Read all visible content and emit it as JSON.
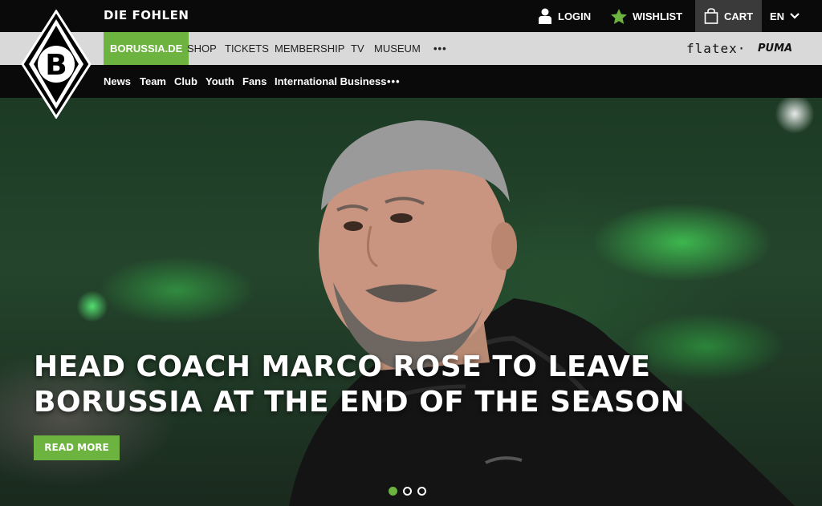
{
  "header": {
    "title": "DIE FOHLEN",
    "login_label": "LOGIN",
    "wishlist_label": "WISHLIST",
    "cart_label": "CART",
    "language": "EN"
  },
  "main_nav": {
    "items": [
      {
        "label": "BORUSSIA.DE"
      },
      {
        "label": "SHOP"
      },
      {
        "label": "TICKETS"
      },
      {
        "label": "MEMBERSHIP"
      },
      {
        "label": "TV"
      },
      {
        "label": "MUSEUM"
      }
    ],
    "more_label": "•••",
    "sponsors": [
      "flatex·",
      "PUMA"
    ]
  },
  "sub_nav": {
    "items": [
      {
        "label": "News"
      },
      {
        "label": "Team"
      },
      {
        "label": "Club"
      },
      {
        "label": "Youth"
      },
      {
        "label": "Fans"
      },
      {
        "label": "International Business"
      }
    ],
    "more_label": "•••"
  },
  "hero": {
    "headline_line1": "HEAD COACH MARCO ROSE TO LEAVE",
    "headline_line2": "BORUSSIA AT THE END OF THE SEASON",
    "cta_label": "READ MORE",
    "slides": 3,
    "active_slide": 1
  },
  "logo_letter": "B",
  "colors": {
    "accent": "#6cb33f",
    "topbar": "#0a0a0a",
    "mainnav": "#d9d9d9"
  }
}
